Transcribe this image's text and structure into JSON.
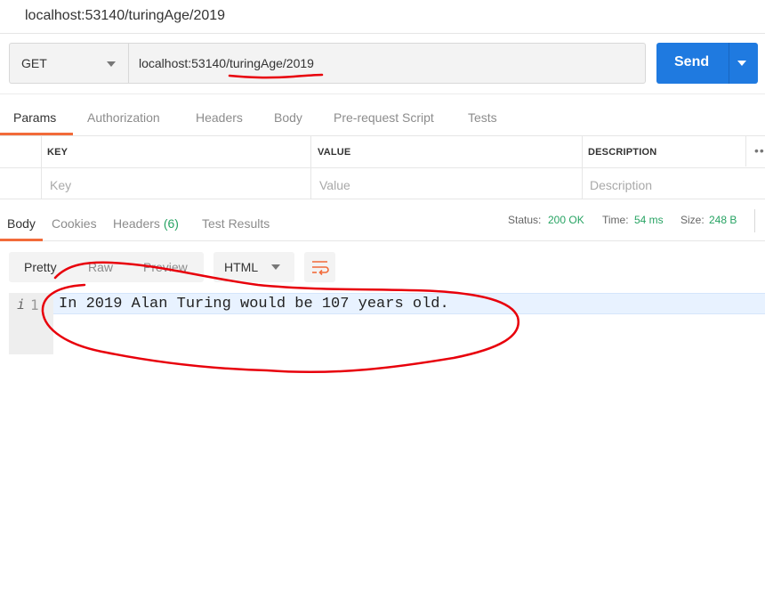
{
  "title": "localhost:53140/turingAge/2019",
  "request": {
    "method": "GET",
    "url": "localhost:53140/turingAge/2019",
    "send_label": "Send"
  },
  "request_tabs": [
    "Params",
    "Authorization",
    "Headers",
    "Body",
    "Pre-request Script",
    "Tests"
  ],
  "params": {
    "headers": {
      "key": "KEY",
      "value": "VALUE",
      "description": "DESCRIPTION"
    },
    "placeholders": {
      "key": "Key",
      "value": "Value",
      "description": "Description"
    },
    "more": "•••"
  },
  "response_tabs": {
    "body": "Body",
    "cookies": "Cookies",
    "headers": "Headers",
    "headers_count": "(6)",
    "test_results": "Test Results"
  },
  "response_status": {
    "status_label": "Status:",
    "status_value": "200 OK",
    "time_label": "Time:",
    "time_value": "54 ms",
    "size_label": "Size:",
    "size_value": "248 B"
  },
  "view_modes": [
    "Pretty",
    "Raw",
    "Preview"
  ],
  "format": "HTML",
  "editor": {
    "line_info": "i",
    "line_number": "1",
    "content": "In 2019 Alan Turing would be 107 years old."
  },
  "colors": {
    "accent": "#1f7ae0",
    "tab_active": "#f26b3a",
    "status_green": "#27a363",
    "annotation": "#e8000b"
  },
  "icons": [
    "chevron-down-icon",
    "send-dropdown-icon",
    "wrap-lines-icon",
    "info-icon"
  ]
}
